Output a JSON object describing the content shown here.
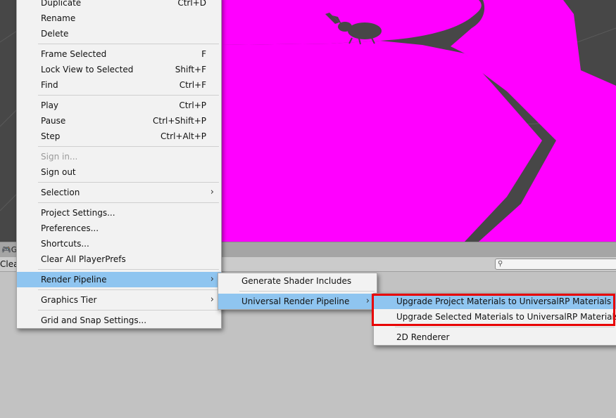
{
  "scene_colors": {
    "background": "#474747",
    "magenta": "#ff00ff",
    "grid": "#5a5a5a"
  },
  "console": {
    "tab_label": "G",
    "tab_icon": "gamepad-icon",
    "clear_label": "Clear",
    "search_icon": "search-icon",
    "search_value": ""
  },
  "main_menu": {
    "items": [
      {
        "label": "Duplicate",
        "shortcut": "Ctrl+D"
      },
      {
        "label": "Rename",
        "shortcut": ""
      },
      {
        "label": "Delete",
        "shortcut": ""
      },
      {
        "separator": true
      },
      {
        "label": "Frame Selected",
        "shortcut": "F"
      },
      {
        "label": "Lock View to Selected",
        "shortcut": "Shift+F"
      },
      {
        "label": "Find",
        "shortcut": "Ctrl+F"
      },
      {
        "separator": true
      },
      {
        "label": "Play",
        "shortcut": "Ctrl+P"
      },
      {
        "label": "Pause",
        "shortcut": "Ctrl+Shift+P"
      },
      {
        "label": "Step",
        "shortcut": "Ctrl+Alt+P"
      },
      {
        "separator": true
      },
      {
        "label": "Sign in...",
        "shortcut": "",
        "disabled": true
      },
      {
        "label": "Sign out",
        "shortcut": ""
      },
      {
        "separator": true
      },
      {
        "label": "Selection",
        "shortcut": "",
        "submenu": true
      },
      {
        "separator": true
      },
      {
        "label": "Project Settings...",
        "shortcut": ""
      },
      {
        "label": "Preferences...",
        "shortcut": ""
      },
      {
        "label": "Shortcuts...",
        "shortcut": ""
      },
      {
        "label": "Clear All PlayerPrefs",
        "shortcut": ""
      },
      {
        "separator": true
      },
      {
        "label": "Render Pipeline",
        "shortcut": "",
        "submenu": true,
        "highlighted": true
      },
      {
        "separator": true
      },
      {
        "label": "Graphics Tier",
        "shortcut": "",
        "submenu": true
      },
      {
        "separator": true
      },
      {
        "label": "Grid and Snap Settings...",
        "shortcut": ""
      }
    ],
    "submenu_arrow": "›"
  },
  "render_pipeline_menu": {
    "items": [
      {
        "label": "Generate Shader Includes"
      },
      {
        "separator": true
      },
      {
        "label": "Universal Render Pipeline",
        "submenu": true,
        "highlighted": true
      }
    ]
  },
  "urp_menu": {
    "items": [
      {
        "label": "Upgrade Project Materials to UniversalRP Materials",
        "highlighted": true
      },
      {
        "label": "Upgrade Selected Materials to UniversalRP Materials"
      },
      {
        "separator": true
      },
      {
        "label": "2D Renderer"
      }
    ]
  },
  "annotation_color": "#e80000"
}
